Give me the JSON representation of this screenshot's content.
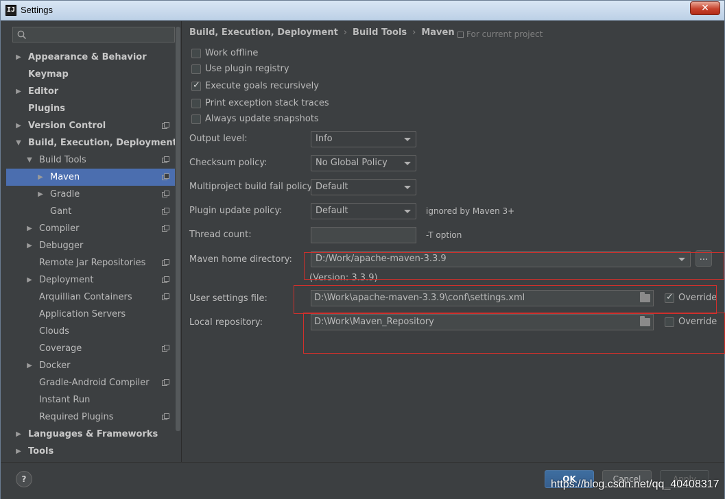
{
  "window": {
    "title": "Settings",
    "app_icon": "IJ",
    "close_symbol": "✕"
  },
  "search": {
    "placeholder": "",
    "value": ""
  },
  "tree": [
    {
      "label": "Appearance & Behavior",
      "arrow": "▶",
      "bold": true,
      "proj": false
    },
    {
      "label": "Keymap",
      "arrow": "",
      "bold": true,
      "proj": false
    },
    {
      "label": "Editor",
      "arrow": "▶",
      "bold": true,
      "proj": false
    },
    {
      "label": "Plugins",
      "arrow": "",
      "bold": true,
      "proj": false
    },
    {
      "label": "Version Control",
      "arrow": "▶",
      "bold": true,
      "proj": true
    },
    {
      "label": "Build, Execution, Deployment",
      "arrow": "▼",
      "bold": true,
      "proj": false
    },
    {
      "label": "Build Tools",
      "arrow": "▼",
      "bold": false,
      "proj": true
    },
    {
      "label": "Maven",
      "arrow": "▶",
      "bold": false,
      "proj": true,
      "selected": true
    },
    {
      "label": "Gradle",
      "arrow": "▶",
      "bold": false,
      "proj": true
    },
    {
      "label": "Gant",
      "arrow": "",
      "bold": false,
      "proj": true
    },
    {
      "label": "Compiler",
      "arrow": "▶",
      "bold": false,
      "proj": true
    },
    {
      "label": "Debugger",
      "arrow": "▶",
      "bold": false,
      "proj": false
    },
    {
      "label": "Remote Jar Repositories",
      "arrow": "",
      "bold": false,
      "proj": true
    },
    {
      "label": "Deployment",
      "arrow": "▶",
      "bold": false,
      "proj": true
    },
    {
      "label": "Arquillian Containers",
      "arrow": "",
      "bold": false,
      "proj": true
    },
    {
      "label": "Application Servers",
      "arrow": "",
      "bold": false,
      "proj": false
    },
    {
      "label": "Clouds",
      "arrow": "",
      "bold": false,
      "proj": false
    },
    {
      "label": "Coverage",
      "arrow": "",
      "bold": false,
      "proj": true
    },
    {
      "label": "Docker",
      "arrow": "▶",
      "bold": false,
      "proj": false
    },
    {
      "label": "Gradle-Android Compiler",
      "arrow": "",
      "bold": false,
      "proj": true
    },
    {
      "label": "Instant Run",
      "arrow": "",
      "bold": false,
      "proj": false
    },
    {
      "label": "Required Plugins",
      "arrow": "",
      "bold": false,
      "proj": true
    },
    {
      "label": "Languages & Frameworks",
      "arrow": "▶",
      "bold": true,
      "proj": false
    },
    {
      "label": "Tools",
      "arrow": "▶",
      "bold": true,
      "proj": false
    }
  ],
  "breadcrumb": {
    "part1": "Build, Execution, Deployment",
    "part2": "Build Tools",
    "part3": "Maven",
    "separator": "›"
  },
  "for_current_project": "For current project",
  "checkboxes": {
    "work_offline": {
      "label": "Work offline",
      "checked": false
    },
    "use_plugin_registry": {
      "label": "Use plugin registry",
      "checked": false
    },
    "execute_goals": {
      "label": "Execute goals recursively",
      "checked": true
    },
    "print_exception": {
      "label": "Print exception stack traces",
      "checked": false
    },
    "always_update": {
      "label": "Always update snapshots",
      "checked": false
    }
  },
  "fields": {
    "output_level": {
      "label": "Output level:",
      "value": "Info"
    },
    "checksum_policy": {
      "label": "Checksum policy:",
      "value": "No Global Policy"
    },
    "multiproject": {
      "label": "Multiproject build fail policy:",
      "value": "Default"
    },
    "plugin_update": {
      "label": "Plugin update policy:",
      "value": "Default",
      "hint": "ignored by Maven 3+"
    },
    "thread_count": {
      "label": "Thread count:",
      "value": "",
      "hint": "-T option"
    },
    "maven_home": {
      "label": "Maven home directory:",
      "value": "D:/Work/apache-maven-3.3.9",
      "browse": "...",
      "version": "(Version: 3.3.9)"
    },
    "user_settings": {
      "label": "User settings file:",
      "value": "D:\\Work\\apache-maven-3.3.9\\conf\\settings.xml",
      "override_label": "Override",
      "override": true
    },
    "local_repo": {
      "label": "Local repository:",
      "value": "D:\\Work\\Maven_Repository",
      "override_label": "Override",
      "override": false
    }
  },
  "buttons": {
    "help": "?",
    "ok": "OK",
    "cancel": "Cancel",
    "apply": "Apply"
  },
  "watermark": "https://blog.csdn.net/qq_40408317",
  "colors": {
    "selection": "#4b6eaf",
    "annotation_red": "#d0302c",
    "background": "#3c3f41"
  }
}
